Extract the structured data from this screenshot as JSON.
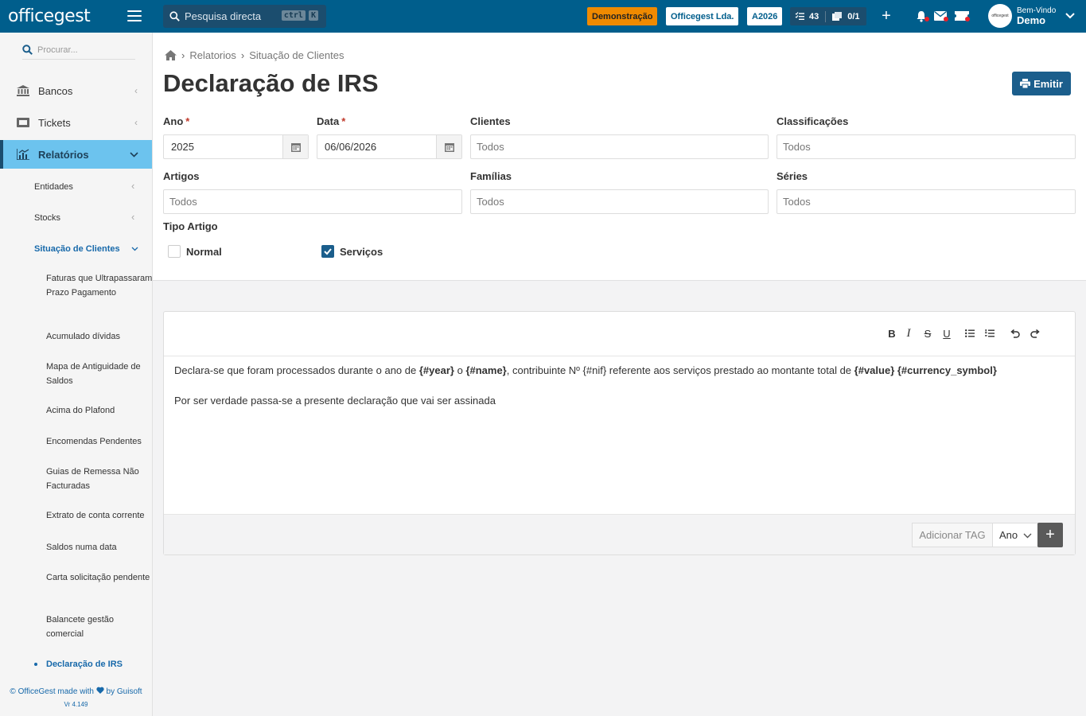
{
  "header": {
    "logo": "officegest",
    "search_placeholder": "Pesquisa directa",
    "kbd": [
      "ctrl",
      "K"
    ],
    "badges": {
      "demo": "Demonstração",
      "company": "Officegest Lda.",
      "year": "A2026",
      "tasks": "43",
      "docs": "0/1"
    },
    "user": {
      "greeting": "Bem-Vindo",
      "name": "Demo",
      "avatar_text": "officegest"
    }
  },
  "sidebar": {
    "search_placeholder": "Procurar...",
    "items": [
      {
        "label": "Bancos",
        "icon": "bank-icon"
      },
      {
        "label": "Tickets",
        "icon": "ticket-icon"
      },
      {
        "label": "Relatórios",
        "icon": "chart-icon"
      }
    ],
    "sub_items": [
      {
        "label": "Entidades"
      },
      {
        "label": "Stocks"
      },
      {
        "label": "Situação de Clientes"
      }
    ],
    "subsub_items": [
      {
        "label": "Faturas que Ultrapassaram Prazo Pagamento"
      },
      {
        "label": "Acumulado dívidas"
      },
      {
        "label": "Mapa de Antiguidade de Saldos"
      },
      {
        "label": "Acima do Plafond"
      },
      {
        "label": "Encomendas Pendentes"
      },
      {
        "label": "Guias de Remessa Não Facturadas"
      },
      {
        "label": "Extrato de conta corrente"
      },
      {
        "label": "Saldos numa data"
      },
      {
        "label": "Carta solicitação pendente"
      },
      {
        "label": "Balancete gestão comercial"
      },
      {
        "label": "Declaração de IRS"
      }
    ],
    "footer": {
      "line1_a": "© OfficeGest made with",
      "line1_b": "by Guisoft",
      "version": "Vr 4.149"
    }
  },
  "breadcrumb": [
    "Relatorios",
    "Situação de Clientes"
  ],
  "page_title": "Declaração de IRS",
  "emit_button": "Emitir",
  "form": {
    "ano": {
      "label": "Ano",
      "value": "2025",
      "required": "*"
    },
    "data": {
      "label": "Data",
      "value": "06/06/2026",
      "required": "*"
    },
    "clientes": {
      "label": "Clientes",
      "placeholder": "Todos"
    },
    "classificacoes": {
      "label": "Classificações",
      "placeholder": "Todos"
    },
    "artigos": {
      "label": "Artigos",
      "placeholder": "Todos"
    },
    "familias": {
      "label": "Famílias",
      "placeholder": "Todos"
    },
    "series": {
      "label": "Séries",
      "placeholder": "Todos"
    },
    "tipo_artigo": {
      "label": "Tipo Artigo",
      "options": [
        {
          "label": "Normal",
          "checked": false
        },
        {
          "label": "Serviços",
          "checked": true
        }
      ]
    }
  },
  "editor": {
    "toolbar": [
      "B",
      "I",
      "S",
      "U"
    ],
    "paragraph1": {
      "t1": "Declara-se que foram processados durante o ano de ",
      "year_tag": "{#year}",
      "t2": " o ",
      "name_tag": "{#name}",
      "t3": ", contribuinte Nº {#nif} referente aos serviços prestado ao montante total de ",
      "value_tag": "{#value}",
      "t4": " ",
      "currency_tag": "{#currency_symbol}"
    },
    "paragraph2": "Por ser verdade passa-se a presente declaração que vai ser assinada",
    "footer": {
      "add_tag_label": "Adicionar TAG",
      "tag_select": "Ano",
      "add_button": "+"
    }
  },
  "colors": {
    "topbar": "#005e8c",
    "accent": "#1b5e8c",
    "active_nav": "#6cc3ee",
    "demo_badge": "#f08a00",
    "link": "#1769aa"
  }
}
